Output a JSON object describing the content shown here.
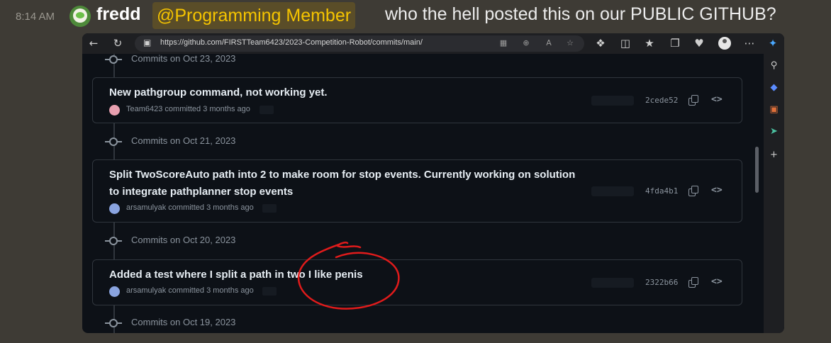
{
  "message": {
    "timestamp": "8:14 AM",
    "username": "fredd",
    "mention": "@Programming Member",
    "text": "who the hell posted this on our PUBLIC GITHUB?"
  },
  "browser": {
    "url": "https://github.com/FIRSTTeam6423/2023-Competition-Robot/commits/main/",
    "icons": [
      "back-icon",
      "refresh-icon",
      "lock-icon",
      "apps-icon",
      "zoom-icon",
      "read-aloud-icon",
      "favorite-icon",
      "extensions-icon",
      "split-screen-icon",
      "favorites-icon",
      "collections-icon",
      "performance-icon",
      "profile-icon",
      "more-icon",
      "copilot-icon"
    ],
    "sidebar_icons": [
      "search-icon",
      "tag-icon",
      "toolbox-icon",
      "paper-plane-icon",
      "plus-icon"
    ]
  },
  "commits": {
    "groups": [
      {
        "date": "Commits on Oct 23, 2023"
      },
      {
        "date": "Commits on Oct 21, 2023"
      },
      {
        "date": "Commits on Oct 20, 2023"
      },
      {
        "date": "Commits on Oct 19, 2023"
      }
    ],
    "items": [
      {
        "title": "New pathgroup command, not working yet.",
        "author": "Team6423",
        "meta": "Team6423 committed 3 months ago",
        "sha": "2cede52"
      },
      {
        "title_line1": "Split TwoScoreAuto path into 2 to make room for stop events. Currently working on solution",
        "title_line2": "to integrate pathplanner stop events",
        "author": "arsamulyak",
        "meta": "arsamulyak committed 3 months ago",
        "sha": "4fda4b1"
      },
      {
        "title": "Added a test where I split a path in two I like penis",
        "author": "arsamulyak",
        "meta": "arsamulyak committed 3 months ago",
        "sha": "2322b66"
      }
    ],
    "code_glyph": "<>"
  },
  "colors": {
    "discord_bg": "#3e3b35",
    "role_gold": "#f5c400",
    "github_bg": "#0d1117",
    "annotation_red": "#e01b1b"
  }
}
